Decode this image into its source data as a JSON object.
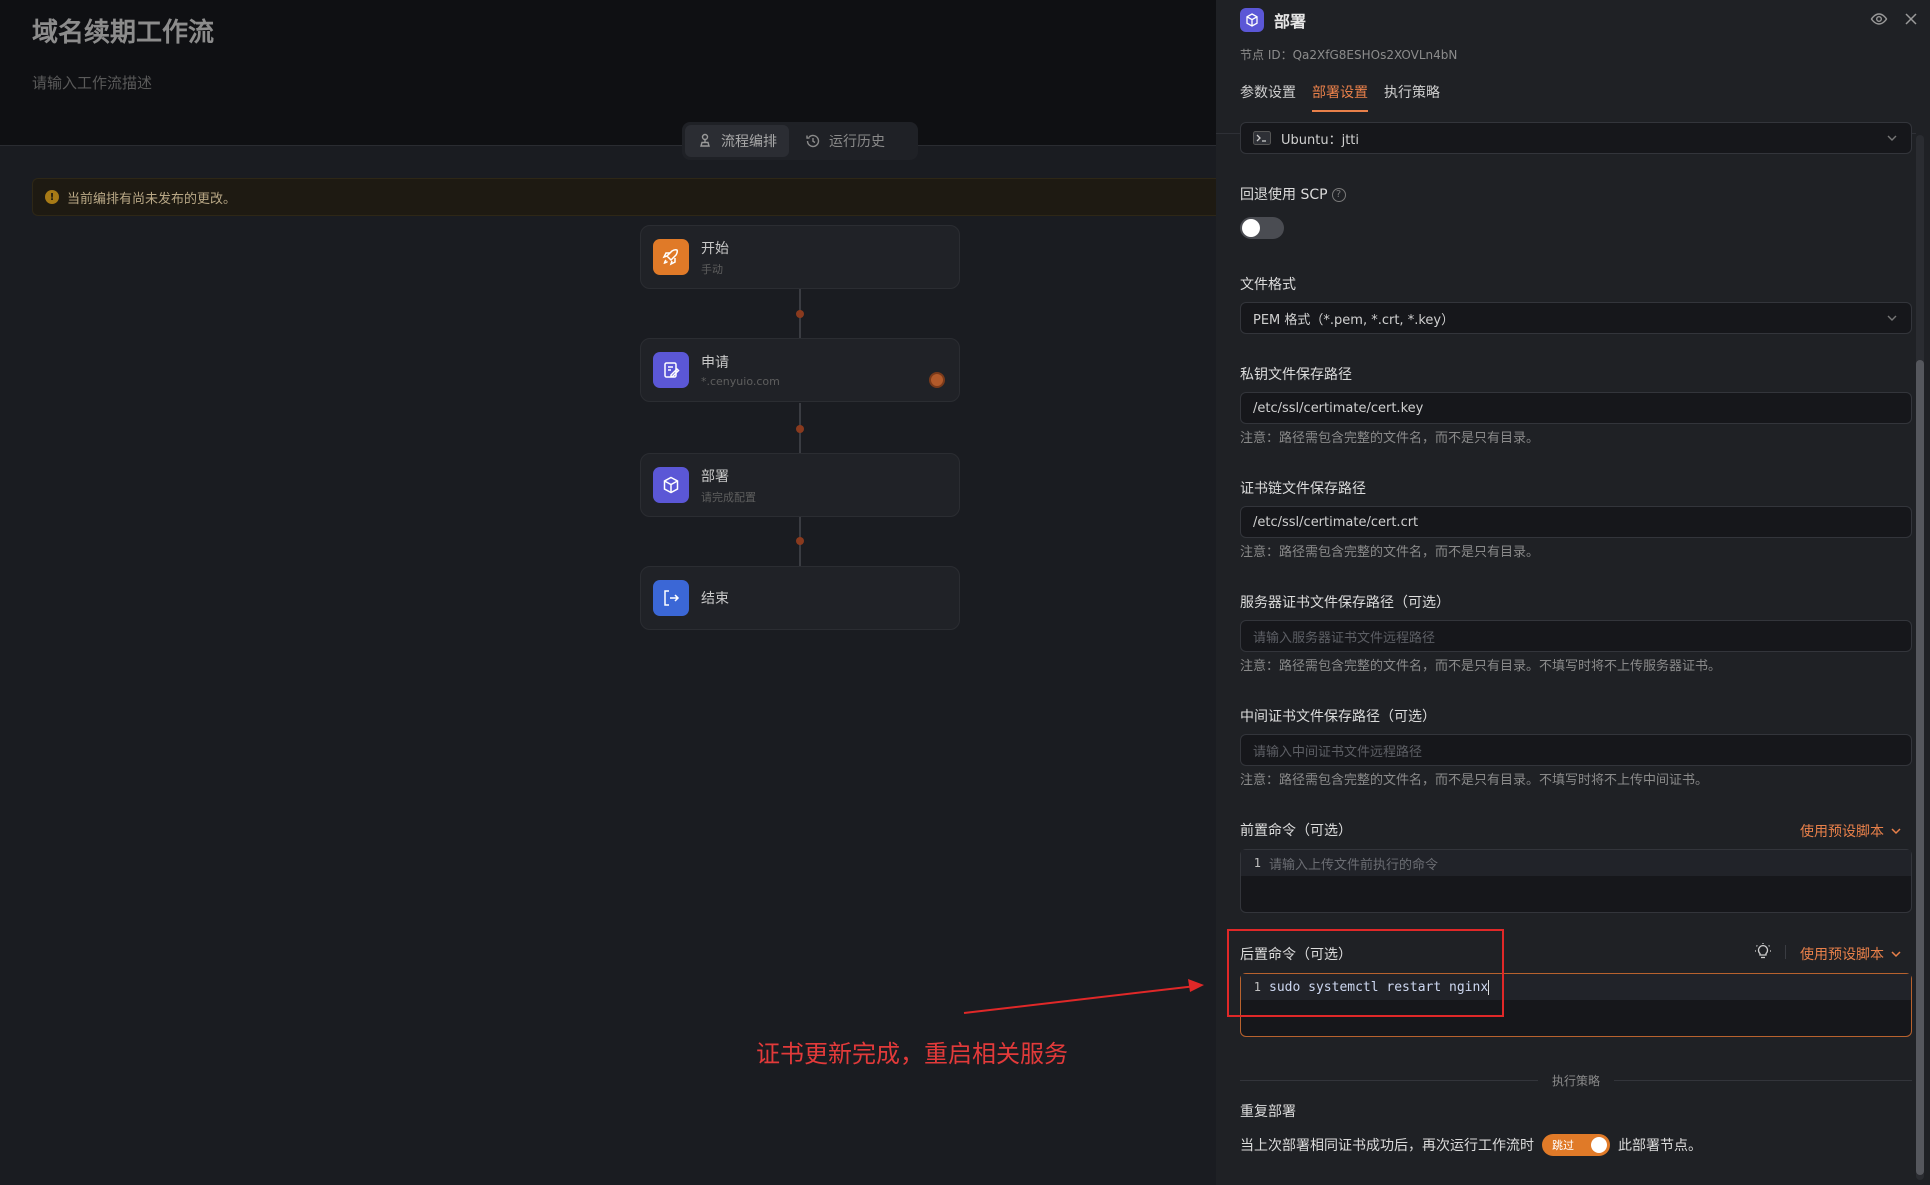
{
  "workflow": {
    "title": "域名续期工作流",
    "description_placeholder": "请输入工作流描述",
    "tabs": [
      {
        "label": "流程编排",
        "icon": "flow-icon"
      },
      {
        "label": "运行历史",
        "icon": "history-icon"
      }
    ],
    "notice": "当前编排有尚未发布的更改。"
  },
  "nodes": [
    {
      "title": "开始",
      "subtitle": "手动",
      "icon": "rocket-icon",
      "color": "#e07a28"
    },
    {
      "title": "申请",
      "subtitle": "*.cenyuio.com",
      "icon": "apply-icon",
      "color": "#5b57d6"
    },
    {
      "title": "部署",
      "subtitle": "请完成配置",
      "icon": "cube-icon",
      "color": "#5b57d6"
    },
    {
      "title": "结束",
      "subtitle": "",
      "icon": "exit-icon",
      "color": "#3b67d6"
    }
  ],
  "annotation": {
    "text": "证书更新完成，重启相关服务"
  },
  "drawer": {
    "title": "部署",
    "icon": "cube-icon",
    "node_id": "节点 ID：Qa2XfG8ESHOs2XOVLn4bN",
    "tabs": [
      "参数设置",
      "部署设置",
      "执行策略"
    ],
    "active_tab": "部署设置",
    "host_select": {
      "value": "Ubuntu：jtti",
      "icon": "terminal-icon"
    },
    "scp_fallback": {
      "label": "回退使用 SCP",
      "enabled": false
    },
    "file_format": {
      "label": "文件格式",
      "value": "PEM 格式（*.pem, *.crt, *.key）"
    },
    "key_path": {
      "label": "私钥文件保存路径",
      "value": "/etc/ssl/certimate/cert.key",
      "hint": "注意：路径需包含完整的文件名，而不是只有目录。"
    },
    "chain_path": {
      "label": "证书链文件保存路径",
      "value": "/etc/ssl/certimate/cert.crt",
      "hint": "注意：路径需包含完整的文件名，而不是只有目录。"
    },
    "server_cert_path": {
      "label": "服务器证书文件保存路径（可选）",
      "placeholder": "请输入服务器证书文件远程路径",
      "hint": "注意：路径需包含完整的文件名，而不是只有目录。不填写时将不上传服务器证书。"
    },
    "intermediate_path": {
      "label": "中间证书文件保存路径（可选）",
      "placeholder": "请输入中间证书文件远程路径",
      "hint": "注意：路径需包含完整的文件名，而不是只有目录。不填写时将不上传中间证书。"
    },
    "pre_command": {
      "label": "前置命令（可选）",
      "preset": "使用预设脚本",
      "line_no": "1",
      "placeholder": "请输入上传文件前执行的命令"
    },
    "post_command": {
      "label": "后置命令（可选）",
      "preset": "使用预设脚本",
      "line_no": "1",
      "value": "sudo systemctl restart nginx"
    },
    "strategy_divider": "执行策略",
    "repeat": {
      "label": "重复部署",
      "text_before": "当上次部署相同证书成功后，再次运行工作流时",
      "toggle_label": "跳过",
      "text_after": "此部署节点。",
      "enabled": true
    }
  },
  "colors": {
    "accent": "#e8804a",
    "annotation": "#e02828"
  }
}
